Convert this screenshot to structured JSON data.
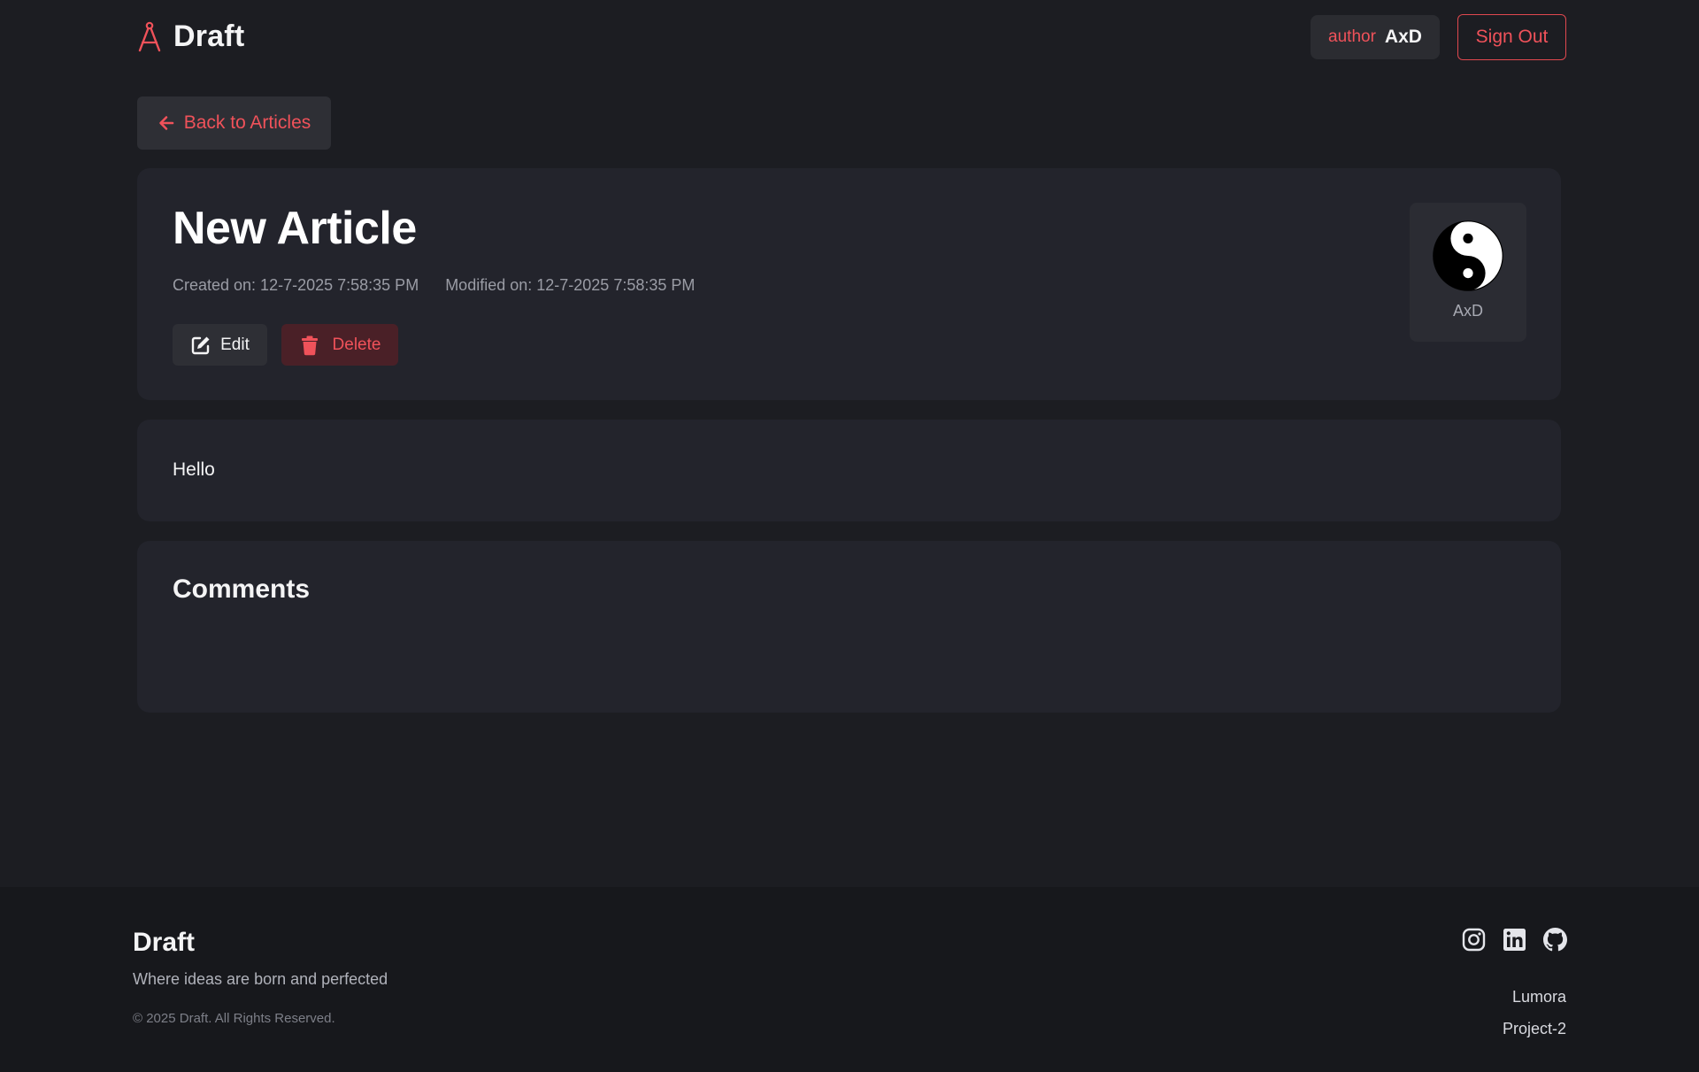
{
  "header": {
    "brand": "Draft",
    "user_role": "author",
    "user_name": "AxD",
    "sign_out_label": "Sign Out"
  },
  "nav": {
    "back_label": "Back to Articles"
  },
  "article": {
    "title": "New Article",
    "created": "Created on: 12-7-2025 7:58:35 PM",
    "modified": "Modified on: 12-7-2025 7:58:35 PM",
    "edit_label": "Edit",
    "delete_label": "Delete",
    "author_name": "AxD",
    "body": "Hello"
  },
  "comments": {
    "title": "Comments"
  },
  "footer": {
    "brand": "Draft",
    "tagline": "Where ideas are born and perfected",
    "copyright": "© 2025 Draft. All Rights Reserved.",
    "social_icons": [
      "instagram-icon",
      "linkedin-icon",
      "github-icon"
    ],
    "links": [
      "Lumora",
      "Project-2"
    ]
  },
  "colors": {
    "accent": "#f0525a",
    "background": "#1c1d22",
    "card": "#23242c",
    "footer": "#17181c"
  }
}
